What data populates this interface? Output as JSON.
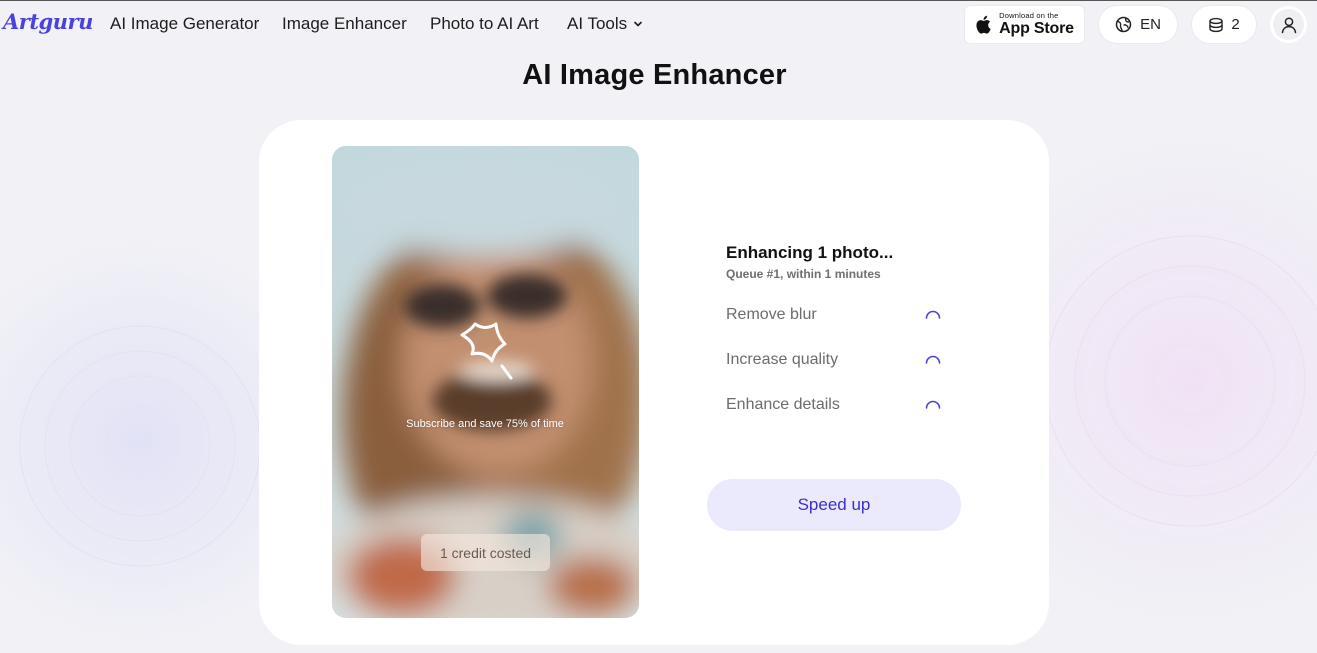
{
  "header": {
    "logo_text": "Artguru",
    "nav": [
      {
        "label": "AI Image Generator"
      },
      {
        "label": "Image Enhancer"
      },
      {
        "label": "Photo to AI Art"
      },
      {
        "label": "AI Tools"
      }
    ],
    "app_store": {
      "small_text": "Download on the",
      "big_text": "App Store",
      "icon": "apple-icon"
    },
    "language": {
      "label": "EN",
      "icon": "globe-icon"
    },
    "credits": {
      "count": "2",
      "icon": "coins-stack-icon"
    },
    "user": {
      "icon": "user-icon"
    }
  },
  "page": {
    "title": "AI Image Enhancer"
  },
  "preview": {
    "overlay_icon": "magic-wand-star-icon",
    "subscribe_text": "Subscribe and save 75% of time",
    "credit_badge": "1 credit costed"
  },
  "status": {
    "title": "Enhancing 1 photo...",
    "queue": "Queue #1, within 1 minutes",
    "steps": [
      {
        "label": "Remove blur",
        "icon": "loading-spinner-icon"
      },
      {
        "label": "Increase quality",
        "icon": "loading-spinner-icon"
      },
      {
        "label": "Enhance details",
        "icon": "loading-spinner-icon"
      }
    ],
    "speed_up_label": "Speed up"
  },
  "colors": {
    "brand": "#4a42e0",
    "button_bg": "#eaeafc",
    "button_text": "#3a2fcf"
  }
}
